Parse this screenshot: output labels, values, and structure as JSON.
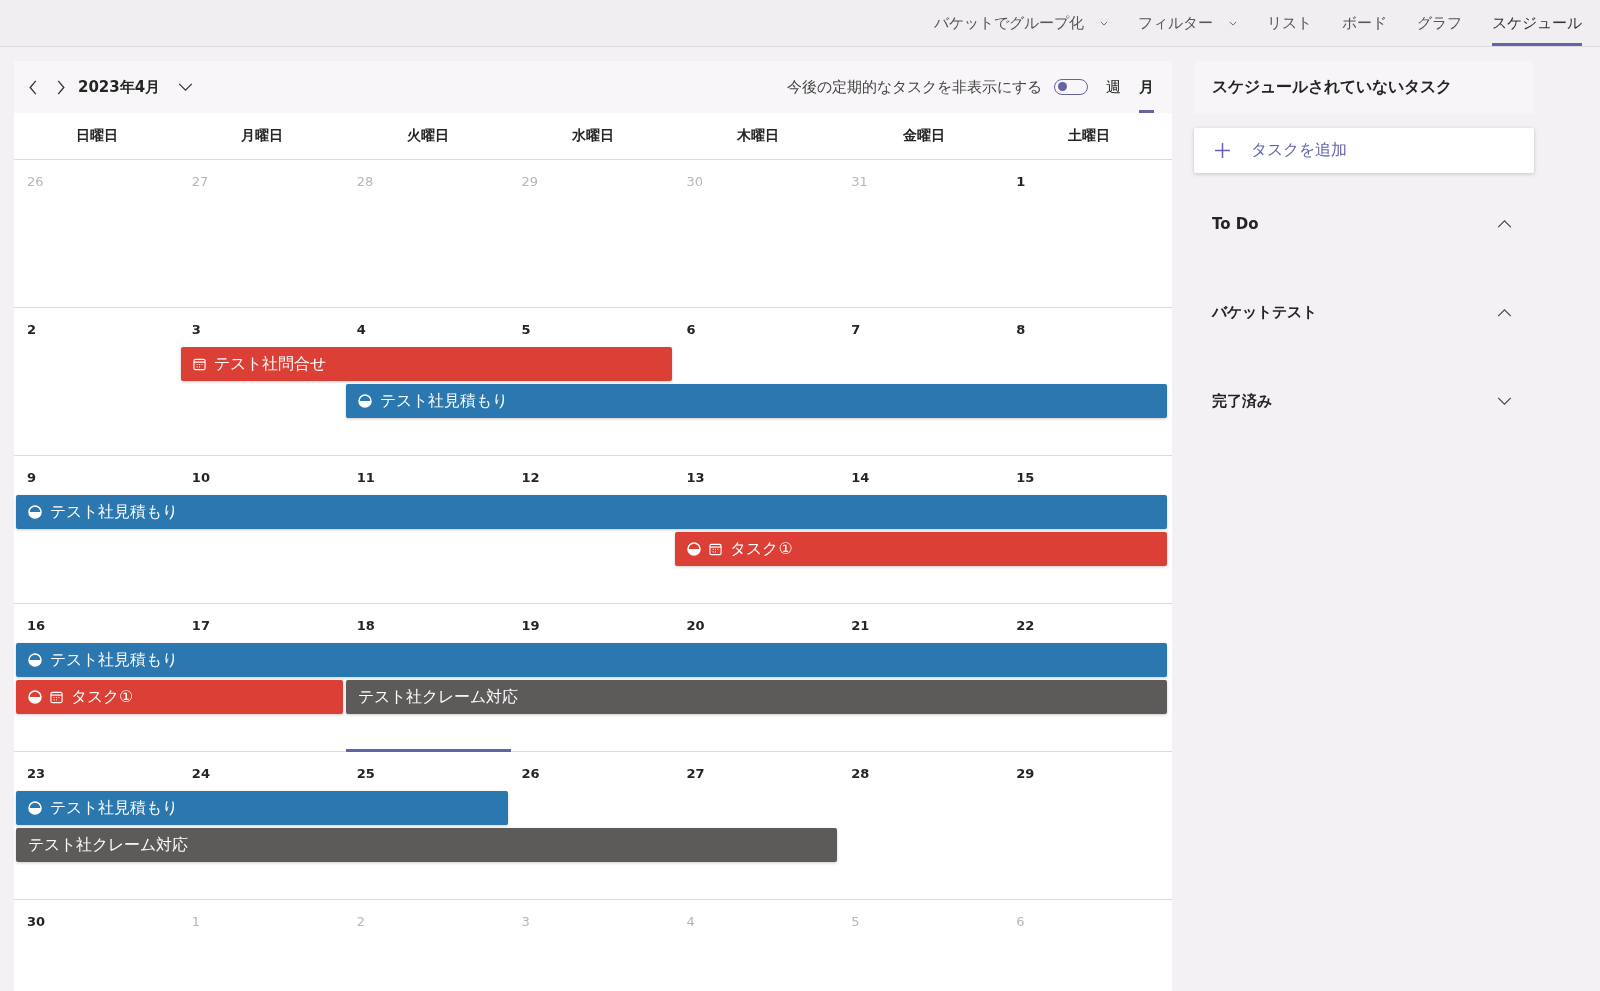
{
  "toolbar": {
    "items": [
      {
        "label": "バケットでグループ化",
        "kind": "dropdown",
        "selected": false
      },
      {
        "label": "フィルター",
        "kind": "dropdown",
        "selected": false
      },
      {
        "label": "リスト",
        "kind": "view",
        "selected": false
      },
      {
        "label": "ボード",
        "kind": "view",
        "selected": false
      },
      {
        "label": "グラフ",
        "kind": "view",
        "selected": false
      },
      {
        "label": "スケジュール",
        "kind": "view",
        "selected": true
      }
    ]
  },
  "calendar": {
    "month": "2023年4月",
    "hide_recurring": {
      "label": "今後の定期的なタスクを非表示にする",
      "on": false
    },
    "views": [
      {
        "label": "週",
        "selected": false
      },
      {
        "label": "月",
        "selected": true
      }
    ],
    "weekdays": [
      "日曜日",
      "月曜日",
      "火曜日",
      "水曜日",
      "木曜日",
      "金曜日",
      "土曜日"
    ],
    "weeks": [
      {
        "days": [
          {
            "date": "26",
            "muted": true,
            "today": false
          },
          {
            "date": "27",
            "muted": true,
            "today": false
          },
          {
            "date": "28",
            "muted": true,
            "today": false
          },
          {
            "date": "29",
            "muted": true,
            "today": false
          },
          {
            "date": "30",
            "muted": true,
            "today": false
          },
          {
            "date": "31",
            "muted": true,
            "today": false
          },
          {
            "date": "1",
            "muted": false,
            "today": false
          }
        ]
      },
      {
        "days": [
          {
            "date": "2",
            "muted": false,
            "today": false
          },
          {
            "date": "3",
            "muted": false,
            "today": false
          },
          {
            "date": "4",
            "muted": false,
            "today": false
          },
          {
            "date": "5",
            "muted": false,
            "today": false
          },
          {
            "date": "6",
            "muted": false,
            "today": false
          },
          {
            "date": "7",
            "muted": false,
            "today": false
          },
          {
            "date": "8",
            "muted": false,
            "today": false
          }
        ],
        "events": [
          {
            "title": "テスト社問合せ",
            "color": "#dc3f35",
            "in_progress": false,
            "dated": true
          },
          {
            "title": "テスト社見積もり",
            "color": "#2b77b0",
            "in_progress": true,
            "dated": false
          }
        ]
      },
      {
        "days": [
          {
            "date": "9",
            "muted": false,
            "today": false
          },
          {
            "date": "10",
            "muted": false,
            "today": false
          },
          {
            "date": "11",
            "muted": false,
            "today": false
          },
          {
            "date": "12",
            "muted": false,
            "today": false
          },
          {
            "date": "13",
            "muted": false,
            "today": false
          },
          {
            "date": "14",
            "muted": false,
            "today": false
          },
          {
            "date": "15",
            "muted": false,
            "today": false
          }
        ],
        "events": [
          {
            "title": "テスト社見積もり",
            "color": "#2b77b0",
            "in_progress": true,
            "dated": false
          },
          {
            "title": "タスク①",
            "color": "#dc3f35",
            "in_progress": true,
            "dated": true
          }
        ]
      },
      {
        "days": [
          {
            "date": "16",
            "muted": false,
            "today": false
          },
          {
            "date": "17",
            "muted": false,
            "today": false
          },
          {
            "date": "18",
            "muted": false,
            "today": false
          },
          {
            "date": "19",
            "muted": false,
            "today": false
          },
          {
            "date": "20",
            "muted": false,
            "today": false
          },
          {
            "date": "21",
            "muted": false,
            "today": false
          },
          {
            "date": "22",
            "muted": false,
            "today": false
          }
        ],
        "events": [
          {
            "title": "テスト社見積もり",
            "color": "#2b77b0",
            "in_progress": true,
            "dated": false
          },
          {
            "title": "タスク①",
            "color": "#dc3f35",
            "in_progress": true,
            "dated": true
          },
          {
            "title": "テスト社クレーム対応",
            "color": "#5d5a5a",
            "in_progress": false,
            "dated": false
          }
        ]
      },
      {
        "days": [
          {
            "date": "23",
            "muted": false,
            "today": false
          },
          {
            "date": "24",
            "muted": false,
            "today": false
          },
          {
            "date": "25",
            "muted": false,
            "today": true
          },
          {
            "date": "26",
            "muted": false,
            "today": false
          },
          {
            "date": "27",
            "muted": false,
            "today": false
          },
          {
            "date": "28",
            "muted": false,
            "today": false
          },
          {
            "date": "29",
            "muted": false,
            "today": false
          }
        ],
        "events": [
          {
            "title": "テスト社見積もり",
            "color": "#2b77b0",
            "in_progress": true,
            "dated": false
          },
          {
            "title": "テスト社クレーム対応",
            "color": "#5d5a5a",
            "in_progress": false,
            "dated": false
          }
        ]
      },
      {
        "days": [
          {
            "date": "30",
            "muted": false,
            "today": false
          },
          {
            "date": "1",
            "muted": true,
            "today": false
          },
          {
            "date": "2",
            "muted": true,
            "today": false
          },
          {
            "date": "3",
            "muted": true,
            "today": false
          },
          {
            "date": "4",
            "muted": true,
            "today": false
          },
          {
            "date": "5",
            "muted": true,
            "today": false
          },
          {
            "date": "6",
            "muted": true,
            "today": false
          }
        ]
      }
    ]
  },
  "unscheduled": {
    "title": "スケジュールされていないタスク",
    "add_task": "タスクを追加",
    "sections": [
      {
        "label": "To Do",
        "expanded": true
      },
      {
        "label": "バケットテスト",
        "expanded": true
      },
      {
        "label": "完了済み",
        "expanded": false
      }
    ]
  }
}
